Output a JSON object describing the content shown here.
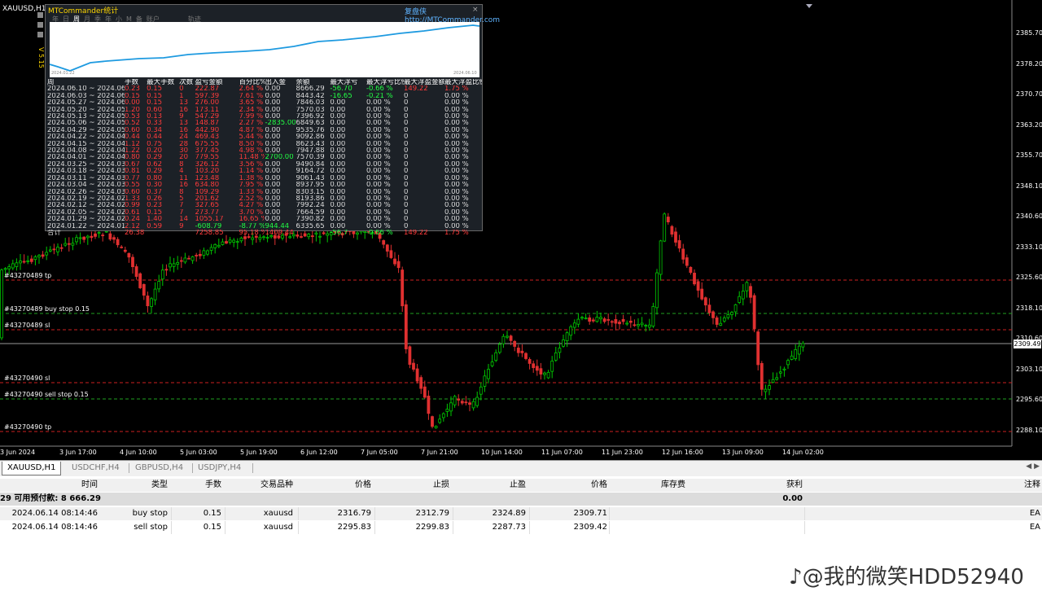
{
  "chart": {
    "symbol_title": "XAUUSD,H1",
    "current_price": "2309.49",
    "price_labels": [
      "2385.70",
      "2378.20",
      "2370.70",
      "2363.20",
      "2355.70",
      "2348.10",
      "2340.60",
      "2333.10",
      "2325.60",
      "2318.10",
      "2310.60",
      "2303.10",
      "2295.60",
      "2288.10"
    ],
    "time_labels": [
      "3 Jun 2024",
      "3 Jun 17:00",
      "4 Jun 10:00",
      "5 Jun 03:00",
      "5 Jun 19:00",
      "6 Jun 12:00",
      "7 Jun 05:00",
      "7 Jun 21:00",
      "10 Jun 14:00",
      "11 Jun 07:00",
      "11 Jun 23:00",
      "12 Jun 16:00",
      "13 Jun 09:00",
      "14 Jun 02:00"
    ],
    "order_labels": [
      {
        "text": "#43270489 tp",
        "color": "#cc2020"
      },
      {
        "text": "#43270489 buy stop 0.15",
        "color": "#20a020"
      },
      {
        "text": "#43270489 sl",
        "color": "#cc2020"
      },
      {
        "text": "#43270490 sl",
        "color": "#cc2020"
      },
      {
        "text": "#43270490 sell stop 0.15",
        "color": "#20a020"
      },
      {
        "text": "#43270490 tp",
        "color": "#cc2020"
      }
    ],
    "bull_color": "#00c800",
    "bear_color": "#e03030"
  },
  "panel": {
    "title": "MTCommander统计",
    "link": "复盘侠 http://MTCommander.com",
    "version": "V 5.15",
    "tabs": [
      "年",
      "日",
      "周",
      "月",
      "季",
      "年",
      "小",
      "M",
      "备",
      "账户",
      "轨迹"
    ],
    "active_tab_index": 2,
    "curve_start_date": "2024.01.22",
    "curve_end_date": "2024.06.10",
    "headers": [
      "周",
      "手数",
      "最大手数",
      "次数",
      "盈亏金额",
      "百分比%",
      "出入金",
      "余额",
      "最大浮亏",
      "最大浮亏比例",
      "最大浮盈金额",
      "最大浮盈比例"
    ],
    "rows": [
      [
        "2024.06.10 ~ 2024.06.16",
        "0.23",
        "0.15",
        "0",
        "222.87",
        "2.64 %",
        "0.00",
        "8666.29",
        "-56.70",
        "-0.66 %",
        "149.22",
        "1.75 %"
      ],
      [
        "2024.06.03 ~ 2024.06.09",
        "0.15",
        "0.15",
        "1",
        "597.39",
        "7.61 %",
        "0.00",
        "8443.42",
        "-16.65",
        "-0.21 %",
        "0",
        "0.00 %"
      ],
      [
        "2024.05.27 ~ 2024.06.02",
        "0.00",
        "0.15",
        "13",
        "276.00",
        "3.65 %",
        "0.00",
        "7846.03",
        "0.00",
        "0.00 %",
        "0",
        "0.00 %"
      ],
      [
        "2024.05.20 ~ 2024.05.26",
        "1.20",
        "0.60",
        "16",
        "173.11",
        "2.34 %",
        "0.00",
        "7570.03",
        "0.00",
        "0.00 %",
        "0",
        "0.00 %"
      ],
      [
        "2024.05.13 ~ 2024.05.19",
        "0.53",
        "0.13",
        "9",
        "547.29",
        "7.99 %",
        "0.00",
        "7396.92",
        "0.00",
        "0.00 %",
        "0",
        "0.00 %"
      ],
      [
        "2024.05.06 ~ 2024.05.12",
        "0.52",
        "0.33",
        "13",
        "148.87",
        "2.27 %",
        "-2835.00",
        "6849.63",
        "0.00",
        "0.00 %",
        "0",
        "0.00 %"
      ],
      [
        "2024.04.29 ~ 2024.05.05",
        "0.60",
        "0.34",
        "16",
        "442.90",
        "4.87 %",
        "0.00",
        "9535.76",
        "0.00",
        "0.00 %",
        "0",
        "0.00 %"
      ],
      [
        "2024.04.22 ~ 2024.04.28",
        "0.44",
        "0.44",
        "24",
        "469.43",
        "5.44 %",
        "0.00",
        "9092.86",
        "0.00",
        "0.00 %",
        "0",
        "0.00 %"
      ],
      [
        "2024.04.15 ~ 2024.04.21",
        "1.12",
        "0.75",
        "28",
        "675.55",
        "8.50 %",
        "0.00",
        "8623.43",
        "0.00",
        "0.00 %",
        "0",
        "0.00 %"
      ],
      [
        "2024.04.08 ~ 2024.04.14",
        "1.22",
        "0.20",
        "30",
        "377.45",
        "4.98 %",
        "0.00",
        "7947.88",
        "0.00",
        "0.00 %",
        "0",
        "0.00 %"
      ],
      [
        "2024.04.01 ~ 2024.04.07",
        "0.80",
        "0.29",
        "20",
        "779.55",
        "11.48 %",
        "2700.00",
        "7570.39",
        "0.00",
        "0.00 %",
        "0",
        "0.00 %"
      ],
      [
        "2024.03.25 ~ 2024.03.31",
        "0.67",
        "0.62",
        "8",
        "326.12",
        "3.56 %",
        "0.00",
        "9490.84",
        "0.00",
        "0.00 %",
        "0",
        "0.00 %"
      ],
      [
        "2024.03.18 ~ 2024.03.24",
        "0.81",
        "0.29",
        "4",
        "103.20",
        "1.14 %",
        "0.00",
        "9164.72",
        "0.00",
        "0.00 %",
        "0",
        "0.00 %"
      ],
      [
        "2024.03.11 ~ 2024.03.17",
        "0.77",
        "0.80",
        "11",
        "123.48",
        "1.38 %",
        "0.00",
        "9061.43",
        "0.00",
        "0.00 %",
        "0",
        "0.00 %"
      ],
      [
        "2024.03.04 ~ 2024.03.10",
        "0.55",
        "0.30",
        "16",
        "634.80",
        "7.95 %",
        "0.00",
        "8937.95",
        "0.00",
        "0.00 %",
        "0",
        "0.00 %"
      ],
      [
        "2024.02.26 ~ 2024.03.03",
        "0.60",
        "0.37",
        "8",
        "109.29",
        "1.33 %",
        "0.00",
        "8303.15",
        "0.00",
        "0.00 %",
        "0",
        "0.00 %"
      ],
      [
        "2024.02.19 ~ 2024.02.25",
        "1.33",
        "0.26",
        "5",
        "201.62",
        "2.52 %",
        "0.00",
        "8193.86",
        "0.00",
        "0.00 %",
        "0",
        "0.00 %"
      ],
      [
        "2024.02.12 ~ 2024.02.18",
        "0.99",
        "0.23",
        "7",
        "327.65",
        "4.27 %",
        "0.00",
        "7992.24",
        "0.00",
        "0.00 %",
        "0",
        "0.00 %"
      ],
      [
        "2024.02.05 ~ 2024.02.11",
        "0.61",
        "0.15",
        "7",
        "273.77",
        "3.70 %",
        "0.00",
        "7664.59",
        "0.00",
        "0.00 %",
        "0",
        "0.00 %"
      ],
      [
        "2024.01.29 ~ 2024.02.04",
        "0.24",
        "1.40",
        "14",
        "1055.17",
        "16.65 %",
        "0.00",
        "7390.82",
        "0.00",
        "0.00 %",
        "0",
        "0.00 %"
      ],
      [
        "2024.01.22 ~ 2024.01.28",
        "2.12",
        "0.59",
        "9",
        "-608.79",
        "-8.77 %",
        "944.44",
        "6335.65",
        "0.00",
        "0.00 %",
        "0",
        "0.00 %"
      ]
    ],
    "total": [
      "合计",
      "26.38",
      "",
      "",
      "7258.85",
      "95.18 %",
      "1409.44",
      "",
      "-56.7",
      "-0.66 %",
      "149.22",
      "1.75 %"
    ]
  },
  "tabs": [
    "XAUUSD,H1",
    "USDCHF,H4",
    "GBPUSD,H4",
    "USDJPY,H4"
  ],
  "terminal": {
    "headers": [
      "时间",
      "类型",
      "手数",
      "交易品种",
      "价格",
      "止损",
      "止盈",
      "价格",
      "库存费",
      "获利",
      "注释"
    ],
    "balance_text": "29  可用预付款: 8 666.29",
    "balance_profit": "0.00",
    "rows": [
      [
        "2024.06.14 08:14:46",
        "buy stop",
        "0.15",
        "xauusd",
        "2316.79",
        "2312.79",
        "2324.89",
        "2309.71",
        "",
        "",
        "EA"
      ],
      [
        "2024.06.14 08:14:46",
        "sell stop",
        "0.15",
        "xauusd",
        "2295.83",
        "2299.83",
        "2287.73",
        "2309.42",
        "",
        "",
        "EA"
      ]
    ]
  },
  "watermark": "@我的微笑HDD52940",
  "watermark_icon": "douyin-icon"
}
